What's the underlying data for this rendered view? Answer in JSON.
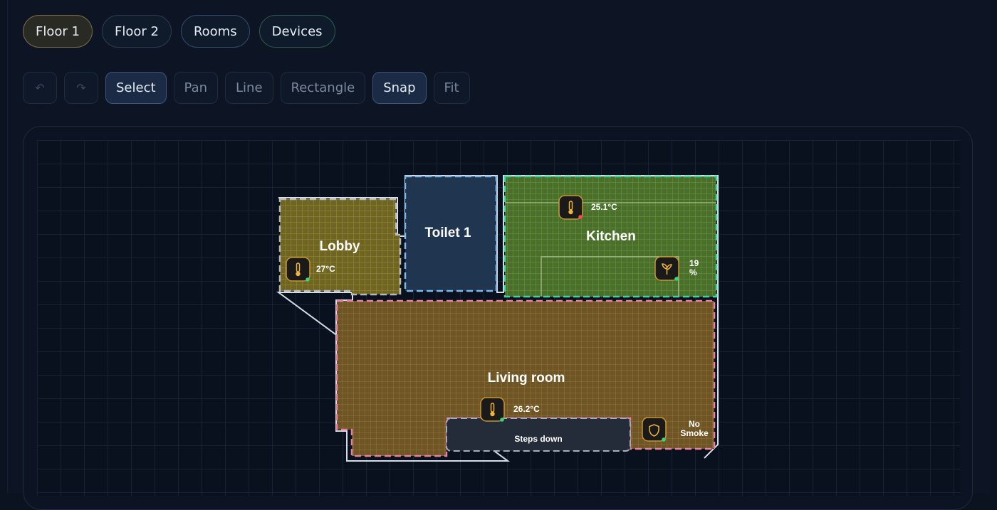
{
  "floor_tabs": [
    {
      "label": "Floor 1",
      "active": true
    },
    {
      "label": "Floor 2",
      "active": false
    },
    {
      "label": "Rooms",
      "active": false
    },
    {
      "label": "Devices",
      "active": false
    }
  ],
  "toolbar": {
    "undo_icon": "undo-icon",
    "redo_icon": "redo-icon",
    "select_label": "Select",
    "pan_label": "Pan",
    "line_label": "Line",
    "rectangle_label": "Rectangle",
    "snap_label": "Snap",
    "fit_label": "Fit"
  },
  "rooms": {
    "lobby": {
      "name": "Lobby",
      "color": "#c9b233"
    },
    "toilet": {
      "name": "Toilet 1",
      "color": "#3a5f86"
    },
    "kitchen": {
      "name": "Kitchen",
      "color": "#6fa83a"
    },
    "living": {
      "name": "Living room",
      "color": "#c8912e"
    },
    "steps": {
      "name": "Steps down"
    }
  },
  "sensors": {
    "lobby_temp": {
      "value": "27°C",
      "icon": "thermometer-icon",
      "status": "#37d67a"
    },
    "kitchen_temp": {
      "value": "25.1°C",
      "icon": "thermometer-icon",
      "status": "#ff4a4a"
    },
    "kitchen_humidity": {
      "value_line1": "19",
      "value_line2": "%",
      "icon": "plant-icon",
      "status": "#37d67a"
    },
    "living_temp": {
      "value": "26.2°C",
      "icon": "thermometer-icon",
      "status": "#37d67a"
    },
    "living_smoke": {
      "value_line1": "No",
      "value_line2": "Smoke",
      "icon": "shield-icon",
      "status": "#37d67a"
    }
  }
}
